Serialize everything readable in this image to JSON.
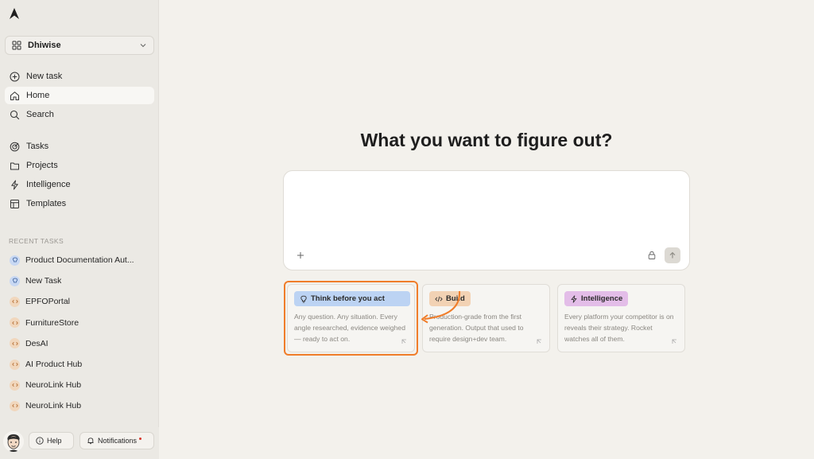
{
  "workspace": {
    "name": "Dhiwise"
  },
  "nav": {
    "new_task": "New task",
    "home": "Home",
    "search": "Search",
    "tasks": "Tasks",
    "projects": "Projects",
    "intelligence": "Intelligence",
    "templates": "Templates"
  },
  "recent": {
    "label": "RECENT TASKS",
    "items": [
      {
        "label": "Product Documentation Aut...",
        "kind": "think"
      },
      {
        "label": "New Task",
        "kind": "think"
      },
      {
        "label": "EPFOPortal",
        "kind": "build"
      },
      {
        "label": "FurnitureStore",
        "kind": "build"
      },
      {
        "label": "DesAI",
        "kind": "build"
      },
      {
        "label": "AI Product Hub",
        "kind": "build"
      },
      {
        "label": "NeuroLink Hub",
        "kind": "build"
      },
      {
        "label": "NeuroLink Hub",
        "kind": "build"
      }
    ]
  },
  "footer": {
    "help": "Help",
    "notifications": "Notifications"
  },
  "main": {
    "headline": "What you want to figure out?",
    "prompt_placeholder": ""
  },
  "cards": [
    {
      "tag": "Think before you act",
      "desc": "Any question. Any situation. Every angle researched, evidence weighed — ready to act on.",
      "color": "#bcd3f3",
      "icon": "lightbulb-icon"
    },
    {
      "tag": "Build",
      "desc": "Production-grade from the first generation. Output that used to require design+dev team.",
      "color": "#f2d2b4",
      "icon": "code-icon"
    },
    {
      "tag": "Intelligence",
      "desc": "Every platform your competitor is on reveals their strategy. Rocket watches all of them.",
      "color": "#e3bde8",
      "icon": "lightning-icon"
    }
  ],
  "colors": {
    "highlight": "#f07d2a",
    "sidebar": "#ebe9e4",
    "background": "#f3f1ec"
  }
}
